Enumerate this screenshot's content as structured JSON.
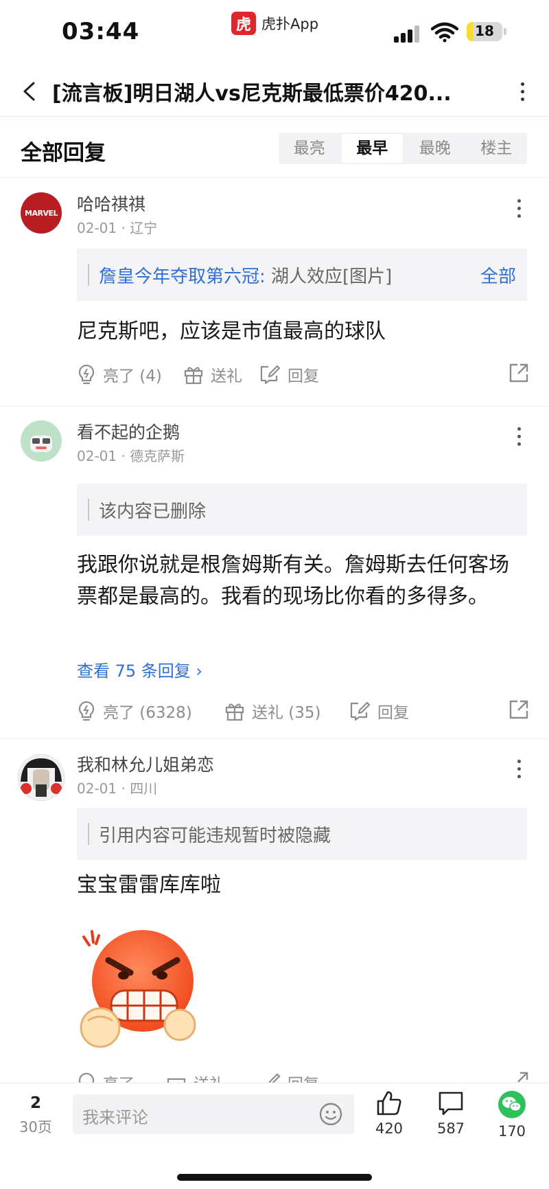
{
  "status_bar": {
    "time": "03:44",
    "app_name": "虎扑App",
    "app_logo_text": "虎",
    "battery": "18",
    "battery_level": 0.18
  },
  "nav": {
    "title": "[流言板]明日湖人vs尼克斯最低票价420..."
  },
  "section": {
    "title": "全部回复",
    "sort_tabs": [
      "最亮",
      "最早",
      "最晚",
      "楼主"
    ],
    "active_tab": "最早"
  },
  "comments": [
    {
      "user": "哈哈祺祺",
      "avatar_text": "MARVEL",
      "meta": "02-01 · 辽宁",
      "quote_link": "詹皇今年夺取第六冠:",
      "quote_text": " 湖人效应[图片]",
      "quote_all": "全部",
      "body": "尼克斯吧，应该是市值最高的球队",
      "like": "亮了 (4)",
      "gift": "送礼",
      "reply": "回复"
    },
    {
      "user": "看不起的企鹅",
      "meta": "02-01 · 德克萨斯",
      "quote_text": "该内容已删除",
      "body": "我跟你说就是根詹姆斯有关。詹姆斯去任何客场票都是最高的。我看的现场比你看的多得多。",
      "view_replies": "查看 75 条回复 ›",
      "like": "亮了 (6328)",
      "gift": "送礼 (35)",
      "reply": "回复"
    },
    {
      "user": "我和林允儿姐弟恋",
      "meta": "02-01 · 四川",
      "quote_text": "引用内容可能违规暂时被隐藏",
      "body": "宝宝雷雷库库啦",
      "like": "亮了",
      "gift": "送礼",
      "reply": "回复"
    }
  ],
  "bottom_bar": {
    "page": "2",
    "total_pages": "30页",
    "comment_placeholder": "我来评论",
    "likes": "420",
    "comments": "587",
    "shares": "170"
  },
  "colors": {
    "accent_blue": "#2f6fd6",
    "brand_red": "#e0262d",
    "wechat_green": "#2ec05a"
  },
  "icons": [
    "back-arrow-icon",
    "more-dots-icon",
    "lightbulb-icon",
    "gift-icon",
    "edit-reply-icon",
    "share-icon",
    "emoji-icon",
    "thumbs-up-icon",
    "comment-bubble-icon",
    "wechat-icon"
  ]
}
